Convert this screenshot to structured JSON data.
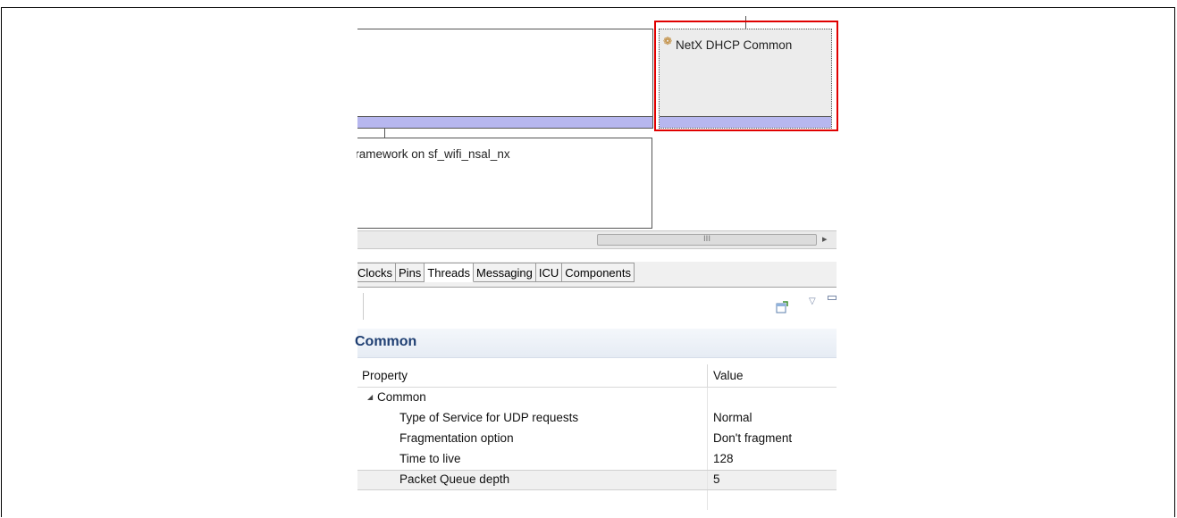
{
  "diagram": {
    "top_right_block": {
      "label": "NetX DHCP Common",
      "icon": "component-icon"
    },
    "middle_block": {
      "label": "Framework on sf_wifi_nsal_nx"
    }
  },
  "scrollbar": {
    "thumb_glyph": "III",
    "arrow_glyph": "▸"
  },
  "tabs": [
    "Clocks",
    "Pins",
    "Threads",
    "Messaging",
    "ICU",
    "Components"
  ],
  "active_tab": "Threads",
  "properties_panel": {
    "title": "Common",
    "toolbar": {
      "new_icon": "new-pin-icon",
      "menu_icon": "view-menu-icon",
      "minimize_icon": "minimize-icon"
    },
    "columns": {
      "property": "Property",
      "value": "Value"
    },
    "group": {
      "label": "Common",
      "expander": "◢"
    },
    "rows": [
      {
        "property": "Type of Service for UDP requests",
        "value": "Normal"
      },
      {
        "property": "Fragmentation option",
        "value": "Don't fragment"
      },
      {
        "property": "Time to live",
        "value": "128"
      },
      {
        "property": "Packet Queue depth",
        "value": "5"
      }
    ]
  },
  "colors": {
    "highlight_box": "#e00000",
    "block_bar": "#b7b7ef",
    "panel_title": "#1f3f72"
  }
}
